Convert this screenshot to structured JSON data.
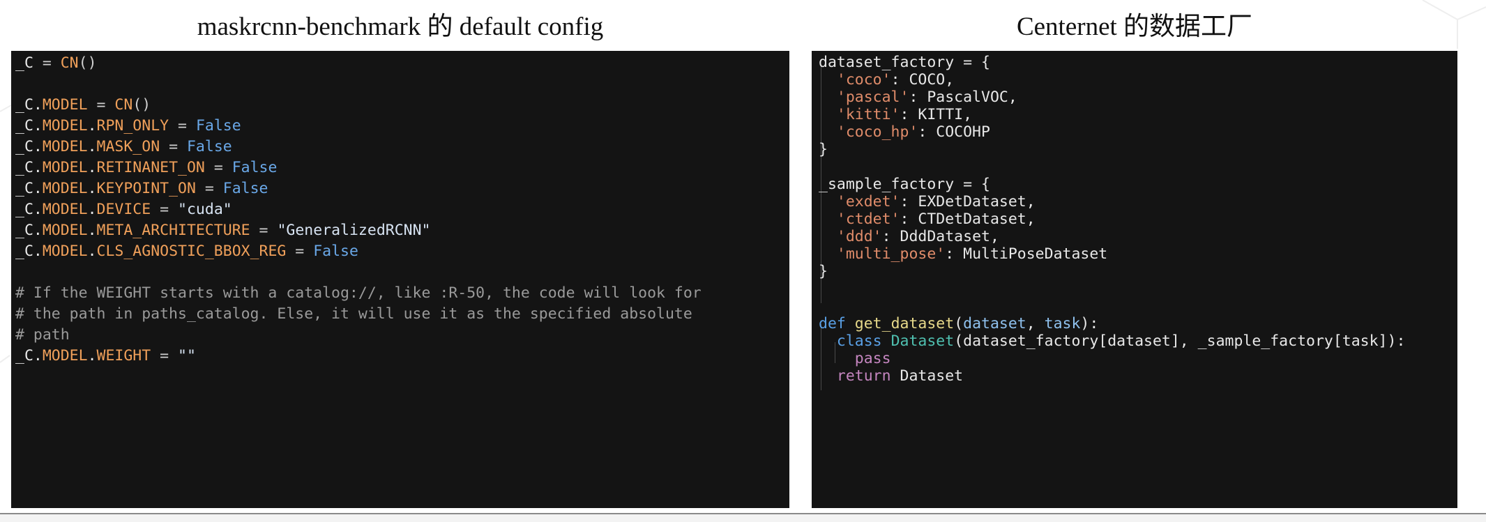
{
  "left_panel": {
    "title": "maskrcnn-benchmark 的 default config",
    "lines": [
      {
        "tokens": [
          [
            "_C",
            "k-var"
          ],
          [
            " = ",
            "k-op"
          ],
          [
            "CN",
            "k-attr"
          ],
          [
            "()",
            "k-op"
          ]
        ]
      },
      {
        "tokens": []
      },
      {
        "tokens": [
          [
            "_C.",
            "k-var"
          ],
          [
            "MODEL",
            "k-attr"
          ],
          [
            " = ",
            "k-op"
          ],
          [
            "CN",
            "k-attr"
          ],
          [
            "()",
            "k-op"
          ]
        ]
      },
      {
        "tokens": [
          [
            "_C.",
            "k-var"
          ],
          [
            "MODEL",
            "k-attr"
          ],
          [
            ".",
            "k-var"
          ],
          [
            "RPN_ONLY",
            "k-attr"
          ],
          [
            " = ",
            "k-op"
          ],
          [
            "False",
            "k-bool"
          ]
        ]
      },
      {
        "tokens": [
          [
            "_C.",
            "k-var"
          ],
          [
            "MODEL",
            "k-attr"
          ],
          [
            ".",
            "k-var"
          ],
          [
            "MASK_ON",
            "k-attr"
          ],
          [
            " = ",
            "k-op"
          ],
          [
            "False",
            "k-bool"
          ]
        ]
      },
      {
        "tokens": [
          [
            "_C.",
            "k-var"
          ],
          [
            "MODEL",
            "k-attr"
          ],
          [
            ".",
            "k-var"
          ],
          [
            "RETINANET_ON",
            "k-attr"
          ],
          [
            " = ",
            "k-op"
          ],
          [
            "False",
            "k-bool"
          ]
        ]
      },
      {
        "tokens": [
          [
            "_C.",
            "k-var"
          ],
          [
            "MODEL",
            "k-attr"
          ],
          [
            ".",
            "k-var"
          ],
          [
            "KEYPOINT_ON",
            "k-attr"
          ],
          [
            " = ",
            "k-op"
          ],
          [
            "False",
            "k-bool"
          ]
        ]
      },
      {
        "tokens": [
          [
            "_C.",
            "k-var"
          ],
          [
            "MODEL",
            "k-attr"
          ],
          [
            ".",
            "k-var"
          ],
          [
            "DEVICE",
            "k-attr"
          ],
          [
            " = ",
            "k-op"
          ],
          [
            "\"cuda\"",
            "k-str"
          ]
        ]
      },
      {
        "tokens": [
          [
            "_C.",
            "k-var"
          ],
          [
            "MODEL",
            "k-attr"
          ],
          [
            ".",
            "k-var"
          ],
          [
            "META_ARCHITECTURE",
            "k-attr"
          ],
          [
            " = ",
            "k-op"
          ],
          [
            "\"GeneralizedRCNN\"",
            "k-str"
          ]
        ]
      },
      {
        "tokens": [
          [
            "_C.",
            "k-var"
          ],
          [
            "MODEL",
            "k-attr"
          ],
          [
            ".",
            "k-var"
          ],
          [
            "CLS_AGNOSTIC_BBOX_REG",
            "k-attr"
          ],
          [
            " = ",
            "k-op"
          ],
          [
            "False",
            "k-bool"
          ]
        ]
      },
      {
        "tokens": []
      },
      {
        "tokens": [
          [
            "# If the WEIGHT starts with a catalog://, like :R-50, the code will look for",
            "k-com"
          ]
        ]
      },
      {
        "tokens": [
          [
            "# the path in paths_catalog. Else, it will use it as the specified absolute",
            "k-com"
          ]
        ]
      },
      {
        "tokens": [
          [
            "# path",
            "k-com"
          ]
        ]
      },
      {
        "tokens": [
          [
            "_C.",
            "k-var"
          ],
          [
            "MODEL",
            "k-attr"
          ],
          [
            ".",
            "k-var"
          ],
          [
            "WEIGHT",
            "k-attr"
          ],
          [
            " = ",
            "k-op"
          ],
          [
            "\"\"",
            "k-str"
          ]
        ]
      }
    ]
  },
  "right_panel": {
    "title": "Centernet 的数据工厂",
    "lines": [
      {
        "tokens": [
          [
            "dataset_factory = {",
            "k-var"
          ]
        ]
      },
      {
        "tokens": [
          [
            "  ",
            "k-var"
          ],
          [
            "'coco'",
            "k-pystr"
          ],
          [
            ": COCO,",
            "k-var"
          ]
        ]
      },
      {
        "tokens": [
          [
            "  ",
            "k-var"
          ],
          [
            "'pascal'",
            "k-pystr"
          ],
          [
            ": PascalVOC,",
            "k-var"
          ]
        ]
      },
      {
        "tokens": [
          [
            "  ",
            "k-var"
          ],
          [
            "'kitti'",
            "k-pystr"
          ],
          [
            ": KITTI,",
            "k-var"
          ]
        ]
      },
      {
        "tokens": [
          [
            "  ",
            "k-var"
          ],
          [
            "'coco_hp'",
            "k-pystr"
          ],
          [
            ": COCOHP",
            "k-var"
          ]
        ]
      },
      {
        "tokens": [
          [
            "}",
            "k-var"
          ]
        ]
      },
      {
        "tokens": []
      },
      {
        "tokens": [
          [
            "_sample_factory = {",
            "k-var"
          ]
        ]
      },
      {
        "tokens": [
          [
            "  ",
            "k-var"
          ],
          [
            "'exdet'",
            "k-pystr"
          ],
          [
            ": EXDetDataset,",
            "k-var"
          ]
        ]
      },
      {
        "tokens": [
          [
            "  ",
            "k-var"
          ],
          [
            "'ctdet'",
            "k-pystr"
          ],
          [
            ": CTDetDataset,",
            "k-var"
          ]
        ]
      },
      {
        "tokens": [
          [
            "  ",
            "k-var"
          ],
          [
            "'ddd'",
            "k-pystr"
          ],
          [
            ": DddDataset,",
            "k-var"
          ]
        ]
      },
      {
        "tokens": [
          [
            "  ",
            "k-var"
          ],
          [
            "'multi_pose'",
            "k-pystr"
          ],
          [
            ": MultiPoseDataset",
            "k-var"
          ]
        ]
      },
      {
        "tokens": [
          [
            "}",
            "k-var"
          ]
        ]
      },
      {
        "tokens": []
      },
      {
        "tokens": []
      },
      {
        "tokens": [
          [
            "def",
            "k-key"
          ],
          [
            " ",
            "k-var"
          ],
          [
            "get_dataset",
            "k-fn"
          ],
          [
            "(",
            "k-var"
          ],
          [
            "dataset",
            "k-param"
          ],
          [
            ", ",
            "k-var"
          ],
          [
            "task",
            "k-param"
          ],
          [
            "):",
            "k-var"
          ]
        ]
      },
      {
        "tokens": [
          [
            "  ",
            "k-var"
          ],
          [
            "class",
            "k-key"
          ],
          [
            " ",
            "k-var"
          ],
          [
            "Dataset",
            "k-cls"
          ],
          [
            "(dataset_factory[dataset], _sample_factory[task]):",
            "k-var"
          ]
        ]
      },
      {
        "tokens": [
          [
            "    ",
            "k-var"
          ],
          [
            "pass",
            "k-pass"
          ]
        ]
      },
      {
        "tokens": [
          [
            "  ",
            "k-var"
          ],
          [
            "return",
            "k-pass"
          ],
          [
            " Dataset",
            "k-var"
          ]
        ]
      }
    ]
  }
}
